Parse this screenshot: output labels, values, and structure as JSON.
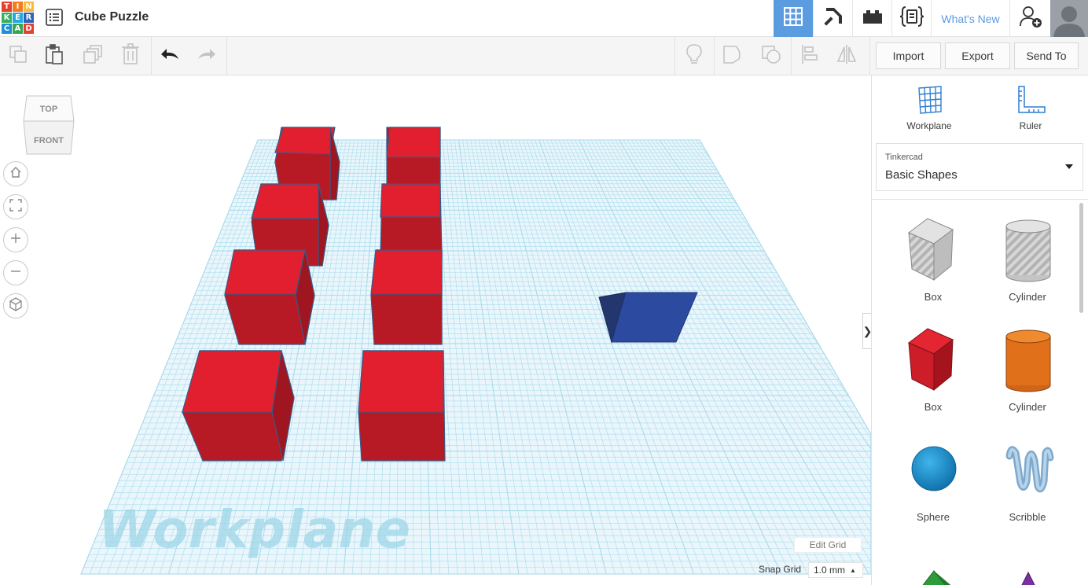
{
  "app": {
    "logo_letters": [
      "T",
      "I",
      "N",
      "K",
      "E",
      "R",
      "C",
      "A",
      "D"
    ],
    "logo_colors": [
      "#e63f2f",
      "#f47b20",
      "#f9b93a",
      "#38b15f",
      "#25a8de",
      "#2f64b4",
      "#1e8fd6",
      "#37a452",
      "#e63f2f"
    ],
    "project_title": "Cube Puzzle",
    "whats_new_label": "What's New"
  },
  "header_icons": {
    "view_3d": "grid-3d-icon",
    "build": "pickaxe-icon",
    "bricks": "bricks-icon",
    "codeblocks": "codeblocks-icon",
    "add_user": "add-user-icon",
    "accent": "#5b9be0"
  },
  "toolbar": {
    "import_label": "Import",
    "export_label": "Export",
    "send_to_label": "Send To"
  },
  "viewcube": {
    "top_label": "TOP",
    "front_label": "FRONT"
  },
  "workplane": {
    "watermark": "Workplane",
    "edit_grid_label": "Edit Grid",
    "snap_grid_label": "Snap Grid",
    "snap_grid_value": "1.0 mm",
    "grid_color": "#a8dcec",
    "shape_colors": {
      "red_box": "#e11f2e",
      "blue_wedge": "#2c4aa0"
    }
  },
  "panel": {
    "workplane_label": "Workplane",
    "ruler_label": "Ruler",
    "library_provider": "Tinkercad",
    "library_name": "Basic Shapes",
    "shapes": [
      {
        "name": "Box",
        "kind": "hole-box"
      },
      {
        "name": "Cylinder",
        "kind": "hole-cylinder"
      },
      {
        "name": "Box",
        "kind": "solid-box"
      },
      {
        "name": "Cylinder",
        "kind": "solid-cylinder"
      },
      {
        "name": "Sphere",
        "kind": "sphere"
      },
      {
        "name": "Scribble",
        "kind": "scribble"
      }
    ]
  }
}
